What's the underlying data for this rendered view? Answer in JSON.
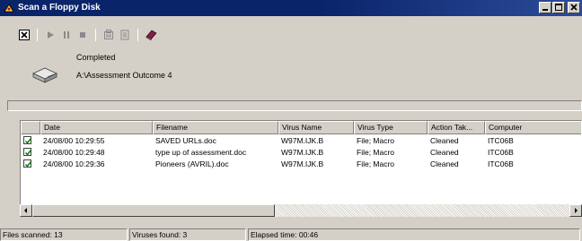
{
  "window": {
    "title": "Scan a Floppy Disk"
  },
  "toolbar": {
    "icons": [
      "close-report-icon",
      "play-icon",
      "pause-icon",
      "stop-icon",
      "properties-icon",
      "report-icon",
      "help-book-icon"
    ]
  },
  "scan": {
    "status": "Completed",
    "path": "A:\\Assessment Outcome 4"
  },
  "table": {
    "columns": [
      "",
      "Date",
      "Filename",
      "Virus Name",
      "Virus Type",
      "Action Tak...",
      "Computer"
    ],
    "rows": [
      {
        "date": "24/08/00 10:29:55",
        "filename": "SAVED URLs.doc",
        "virus": "W97M.IJK.B",
        "type": "File; Macro",
        "action": "Cleaned",
        "computer": "ITC06B"
      },
      {
        "date": "24/08/00 10:29:48",
        "filename": "type up of assessment.doc",
        "virus": "W97M.IJK.B",
        "type": "File; Macro",
        "action": "Cleaned",
        "computer": "ITC06B"
      },
      {
        "date": "24/08/00 10:29:36",
        "filename": "Pioneers (AVRIL).doc",
        "virus": "W97M.IJK.B",
        "type": "File; Macro",
        "action": "Cleaned",
        "computer": "ITC06B"
      }
    ]
  },
  "status": {
    "files_scanned": "Files scanned: 13",
    "viruses_found": "Viruses found: 3",
    "elapsed": "Elapsed time: 00:46"
  },
  "colors": {
    "titlebar": "#0a246a",
    "face": "#d4d0c8",
    "check": "#008000"
  }
}
